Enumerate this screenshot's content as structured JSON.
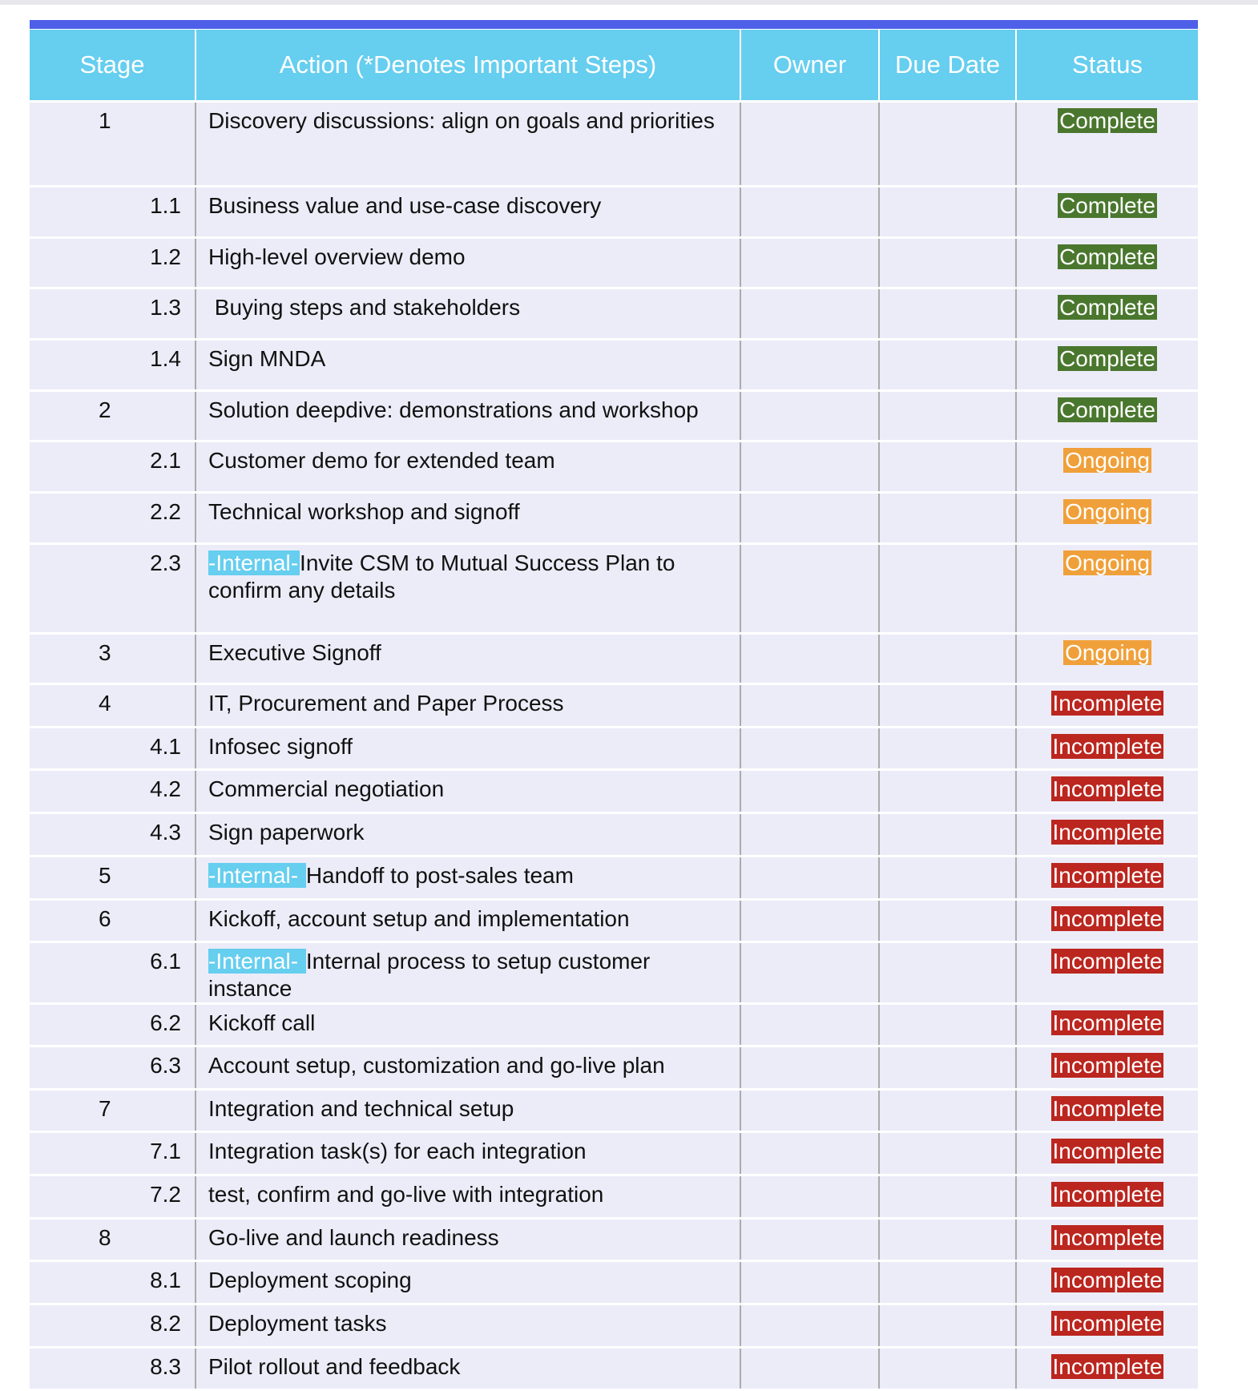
{
  "colors": {
    "header_bg": "#66ceef",
    "top_bar": "#4e5fe8",
    "row_bg": "#ececf8",
    "complete": "#4a772e",
    "ongoing": "#f0a03a",
    "incomplete": "#bb261f",
    "internal_tag": "#66ceef"
  },
  "table": {
    "headers": {
      "stage": "Stage",
      "action": "Action (*Denotes Important Steps)",
      "owner": "Owner",
      "due_date": "Due Date",
      "status": "Status"
    },
    "rows": [
      {
        "stage": "1",
        "level": "main",
        "tag": "",
        "action": "Discovery discussions: align on goals and priorities",
        "owner": "",
        "due_date": "",
        "status": "Complete"
      },
      {
        "stage": "1.1",
        "level": "sub",
        "tag": "",
        "action": "Business value and use-case discovery",
        "owner": "",
        "due_date": "",
        "status": "Complete"
      },
      {
        "stage": "1.2",
        "level": "sub",
        "tag": "",
        "action": "High-level overview demo",
        "owner": "",
        "due_date": "",
        "status": "Complete"
      },
      {
        "stage": "1.3",
        "level": "sub",
        "tag": "",
        "action": " Buying steps and stakeholders",
        "owner": "",
        "due_date": "",
        "status": "Complete"
      },
      {
        "stage": "1.4",
        "level": "sub",
        "tag": "",
        "action": "Sign MNDA",
        "owner": "",
        "due_date": "",
        "status": "Complete"
      },
      {
        "stage": "2",
        "level": "main",
        "tag": "",
        "action": "Solution deepdive: demonstrations and workshop",
        "owner": "",
        "due_date": "",
        "status": "Complete"
      },
      {
        "stage": "2.1",
        "level": "sub",
        "tag": "",
        "action": "Customer demo for extended team",
        "owner": "",
        "due_date": "",
        "status": "Ongoing"
      },
      {
        "stage": "2.2",
        "level": "sub",
        "tag": "",
        "action": "Technical workshop and signoff",
        "owner": "",
        "due_date": "",
        "status": "Ongoing"
      },
      {
        "stage": "2.3",
        "level": "sub",
        "tag": "-Internal-",
        "action": "Invite CSM to Mutual Success Plan to confirm any details",
        "owner": "",
        "due_date": "",
        "status": "Ongoing"
      },
      {
        "stage": "3",
        "level": "main",
        "tag": "",
        "action": "Executive Signoff",
        "owner": "",
        "due_date": "",
        "status": "Ongoing"
      },
      {
        "stage": "4",
        "level": "main",
        "tag": "",
        "action": "IT, Procurement and Paper Process",
        "owner": "",
        "due_date": "",
        "status": "Incomplete"
      },
      {
        "stage": "4.1",
        "level": "sub",
        "tag": "",
        "action": "Infosec signoff",
        "owner": "",
        "due_date": "",
        "status": "Incomplete"
      },
      {
        "stage": "4.2",
        "level": "sub",
        "tag": "",
        "action": "Commercial negotiation",
        "owner": "",
        "due_date": "",
        "status": "Incomplete"
      },
      {
        "stage": "4.3",
        "level": "sub",
        "tag": "",
        "action": "Sign paperwork",
        "owner": "",
        "due_date": "",
        "status": "Incomplete"
      },
      {
        "stage": "5",
        "level": "main",
        "tag": "-Internal- ",
        "action": "Handoff to post-sales team",
        "owner": "",
        "due_date": "",
        "status": "Incomplete"
      },
      {
        "stage": "6",
        "level": "main",
        "tag": "",
        "action": "Kickoff, account setup and implementation",
        "owner": "",
        "due_date": "",
        "status": "Incomplete"
      },
      {
        "stage": "6.1",
        "level": "sub",
        "tag": "-Internal- ",
        "action": "Internal process to setup customer instance",
        "owner": "",
        "due_date": "",
        "status": "Incomplete"
      },
      {
        "stage": "6.2",
        "level": "sub",
        "tag": "",
        "action": "Kickoff call",
        "owner": "",
        "due_date": "",
        "status": "Incomplete"
      },
      {
        "stage": "6.3",
        "level": "sub",
        "tag": "",
        "action": "Account setup, customization and go-live plan",
        "owner": "",
        "due_date": "",
        "status": "Incomplete"
      },
      {
        "stage": "7",
        "level": "main",
        "tag": "",
        "action": "Integration and technical setup",
        "owner": "",
        "due_date": "",
        "status": "Incomplete"
      },
      {
        "stage": "7.1",
        "level": "sub",
        "tag": "",
        "action": "Integration task(s) for each integration",
        "owner": "",
        "due_date": "",
        "status": "Incomplete"
      },
      {
        "stage": "7.2",
        "level": "sub",
        "tag": "",
        "action": "test, confirm and go-live with integration",
        "owner": "",
        "due_date": "",
        "status": "Incomplete"
      },
      {
        "stage": "8",
        "level": "main",
        "tag": "",
        "action": "Go-live and launch readiness",
        "owner": "",
        "due_date": "",
        "status": "Incomplete"
      },
      {
        "stage": "8.1",
        "level": "sub",
        "tag": "",
        "action": "Deployment scoping",
        "owner": "",
        "due_date": "",
        "status": "Incomplete"
      },
      {
        "stage": "8.2",
        "level": "sub",
        "tag": "",
        "action": "Deployment tasks",
        "owner": "",
        "due_date": "",
        "status": "Incomplete"
      },
      {
        "stage": "8.3",
        "level": "sub",
        "tag": "",
        "action": "Pilot rollout and feedback",
        "owner": "",
        "due_date": "",
        "status": "Incomplete"
      }
    ]
  }
}
